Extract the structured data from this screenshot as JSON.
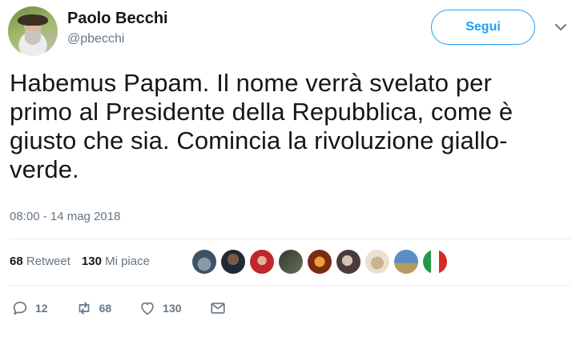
{
  "user": {
    "name": "Paolo Becchi",
    "handle": "@pbecchi"
  },
  "follow_label": "Segui",
  "tweet": {
    "lines": [
      "Habemus Papam. Il nome verrà svelato per",
      "primo al Presidente della Repubblica, come è",
      "giusto che sia. Comincia la rivoluzione giallo-",
      "verde."
    ],
    "timestamp": "08:00 - 14 mag 2018"
  },
  "stats": {
    "retweets": "68",
    "retweets_label": "Retweet",
    "likes": "130",
    "likes_label": "Mi piace"
  },
  "actions": {
    "replies": "12",
    "retweets": "68",
    "likes": "130"
  },
  "colors": {
    "accent": "#1da1f2",
    "secondary_text": "#657786",
    "divider": "#e6ecf0"
  }
}
